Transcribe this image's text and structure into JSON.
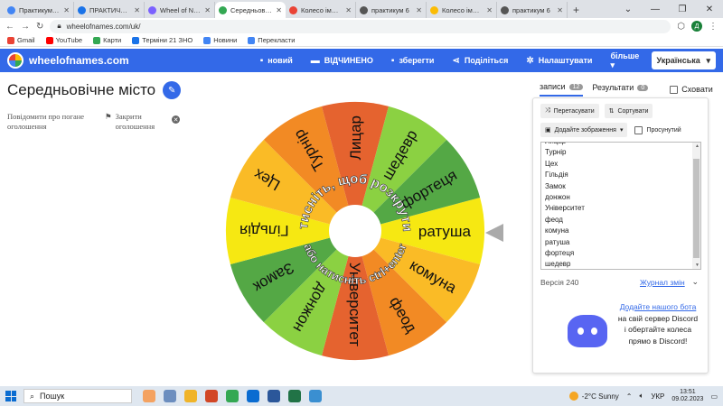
{
  "browser": {
    "tabs": [
      {
        "label": "Практикум для с...",
        "color": "#4285f4",
        "active": false
      },
      {
        "label": "ПРАКТИЧНІ РОБ...",
        "color": "#1a73e8",
        "active": false
      },
      {
        "label": "Wheel of Names",
        "color": "#7b61ff",
        "active": false
      },
      {
        "label": "Середньовічне с...",
        "color": "#34a853",
        "active": true
      },
      {
        "label": "Колесо імен | Ви...",
        "color": "#ea4335",
        "active": false
      },
      {
        "label": "практикум 6",
        "color": "#555",
        "active": false
      },
      {
        "label": "Колесо імен | Ге...",
        "color": "#fbbc05",
        "active": false
      },
      {
        "label": "практикум 6",
        "color": "#555",
        "active": false
      }
    ],
    "new_tab": "+",
    "window_controls": [
      "⌄",
      "—",
      "❐",
      "✕"
    ],
    "url": "wheelofnames.com/uk/",
    "profile_initial": "Д"
  },
  "bookmarks": [
    {
      "label": "Gmail",
      "color": "#ea4335"
    },
    {
      "label": "YouTube",
      "color": "#ff0000"
    },
    {
      "label": "Карти",
      "color": "#34a853"
    },
    {
      "label": "Терміни 21 ЗНО",
      "color": "#1a73e8"
    },
    {
      "label": "Новини",
      "color": "#4285f4"
    },
    {
      "label": "Перекласти",
      "color": "#4285f4"
    }
  ],
  "appbar": {
    "logo": "wheelofnames.com",
    "nav": [
      {
        "icon": "file-icon",
        "glyph": "▪",
        "label": "новий"
      },
      {
        "icon": "folder-icon",
        "glyph": "▬",
        "label": "ВІДЧИНЕНО"
      },
      {
        "icon": "save-icon",
        "glyph": "▪",
        "label": "зберегти"
      },
      {
        "icon": "share-icon",
        "glyph": "⋖",
        "label": "Поділіться"
      },
      {
        "icon": "gear-icon",
        "glyph": "✲",
        "label": "Налаштувати"
      },
      {
        "icon": "more-icon",
        "glyph": "",
        "label": "більше ▾"
      }
    ],
    "language": "Українська"
  },
  "wheel": {
    "title": "Середньовічне місто",
    "report_text": "Повідомити про погане оголошення",
    "close_ad_text": "Закрити оголошення",
    "center_color": "#ffffff",
    "overlay_text": "Натисніть, щоб розкрутити",
    "overlay_text_lower": "або натисніть ctrl+enter",
    "segments": [
      {
        "label": "ратуша",
        "color": "#f6e812"
      },
      {
        "label": "комуна",
        "color": "#fabb26"
      },
      {
        "label": "феод",
        "color": "#f28a24"
      },
      {
        "label": "Університет",
        "color": "#e5632f"
      },
      {
        "label": "донжон",
        "color": "#8bd142"
      },
      {
        "label": "Замок",
        "color": "#54a845"
      },
      {
        "label": "Гільдія",
        "color": "#f6e812"
      },
      {
        "label": "Цех",
        "color": "#fabb26"
      },
      {
        "label": "Турнір",
        "color": "#f28a24"
      },
      {
        "label": "Лицар",
        "color": "#e5632f"
      },
      {
        "label": "шедевр",
        "color": "#8bd142"
      },
      {
        "label": "фортеця",
        "color": "#54a845"
      }
    ]
  },
  "panel": {
    "tabs": [
      {
        "label": "записи",
        "count": "12"
      },
      {
        "label": "Результати",
        "count": "0"
      }
    ],
    "hide_label": "Сховати",
    "shuffle_label": "Перетасувати",
    "sort_label": "Сортувати",
    "add_image_label": "Додайте зображення",
    "advanced_label": "Просунутий",
    "entries": [
      "Лицар",
      "Турнір",
      "Цех",
      "Гільдія",
      "Замок",
      "донжон",
      "Університет",
      "феод",
      "комуна",
      "ратуша",
      "фортеця",
      "шедевр"
    ],
    "version": "Версія 240",
    "changelog": "Журнал змін",
    "discord_link": "Додайте нашого бота",
    "discord_text": "на свій сервер Discord і обертайте колеса прямо в Discord!"
  },
  "taskbar": {
    "search": "Пошук",
    "apps": [
      "#f4a261",
      "#6c8ebf",
      "#f0b429",
      "#d24726",
      "#34a853",
      "#0a6cd1",
      "#2b579a",
      "#217346",
      "#3a8fd1"
    ],
    "weather": "-2°C  Sunny",
    "lang": "УКР",
    "time": "13:51",
    "date": "09.02.2023"
  }
}
